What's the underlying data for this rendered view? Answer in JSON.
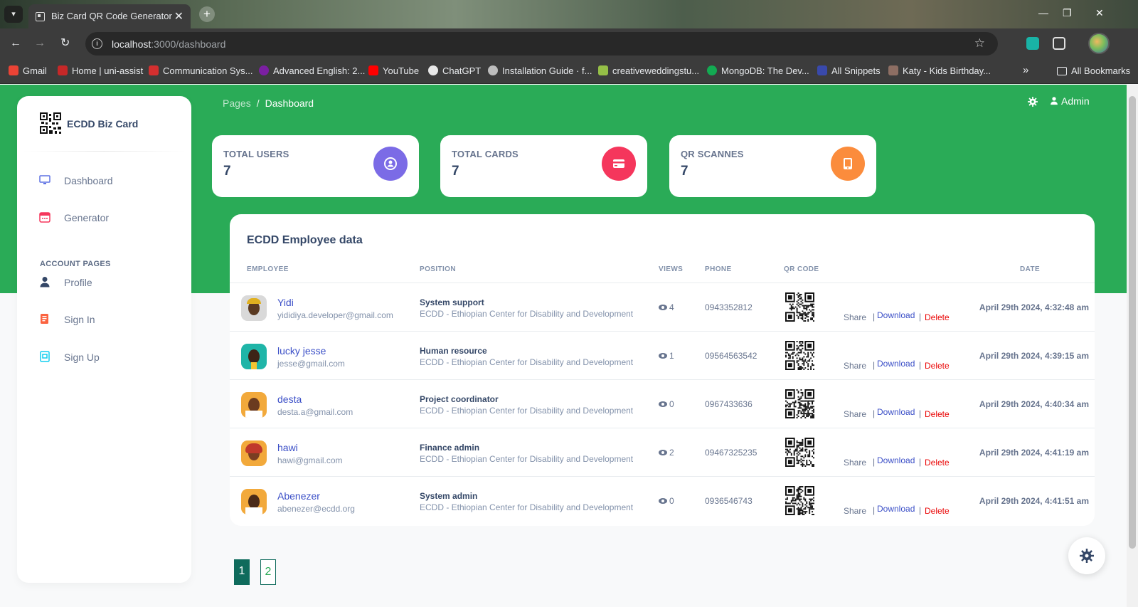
{
  "browser": {
    "tab_title": "Biz Card QR Code Generator",
    "tab_close": "✕",
    "new_tab": "+",
    "url_host": "localhost",
    "url_path": ":3000/dashboard",
    "bookmarks": [
      {
        "label": "Gmail",
        "color": "#ea4335"
      },
      {
        "label": "Home | uni-assist",
        "color": "#c62828"
      },
      {
        "label": "Communication Sys...",
        "color": "#d32f2f"
      },
      {
        "label": "Advanced English: 2...",
        "color": "#7b1fa2"
      },
      {
        "label": "YouTube",
        "color": "#ff0000"
      },
      {
        "label": "ChatGPT",
        "color": "#e8e8e8"
      },
      {
        "label": "Installation Guide · f...",
        "color": "#bdbdbd"
      },
      {
        "label": "creativeweddingstu...",
        "color": "#95bf47"
      },
      {
        "label": "MongoDB: The Dev...",
        "color": "#13aa52"
      },
      {
        "label": "All Snippets",
        "color": "#3949ab"
      },
      {
        "label": "Katy - Kids Birthday...",
        "color": "#8d6e63"
      }
    ],
    "more_bookmarks": "»",
    "all_bookmarks": "All Bookmarks"
  },
  "sidebar": {
    "brand": "ECDD Biz Card",
    "items": [
      {
        "label": "Dashboard",
        "icon": "monitor-icon",
        "color": "#5e72e4"
      },
      {
        "label": "Generator",
        "icon": "calendar-icon",
        "color": "#f5365c"
      }
    ],
    "section_heading": "ACCOUNT PAGES",
    "account_items": [
      {
        "label": "Profile",
        "icon": "user-icon",
        "color": "#344767"
      },
      {
        "label": "Sign In",
        "icon": "document-icon",
        "color": "#fb6340"
      },
      {
        "label": "Sign Up",
        "icon": "id-card-icon",
        "color": "#11cdef"
      }
    ]
  },
  "header": {
    "breadcrumb_parent": "Pages",
    "breadcrumb_sep": "/",
    "breadcrumb_current": "Dashboard",
    "user_label": "Admin"
  },
  "stats": [
    {
      "label": "TOTAL USERS",
      "value": "7",
      "icon": "user-circle-icon",
      "color": "#7b6be6"
    },
    {
      "label": "TOTAL CARDS",
      "value": "7",
      "icon": "credit-card-icon",
      "color": "#f5365c"
    },
    {
      "label": "QR SCANNES",
      "value": "7",
      "icon": "tablet-icon",
      "color": "#fb8c3c"
    }
  ],
  "table": {
    "title": "ECDD Employee data",
    "columns": [
      "EMPLOYEE",
      "POSITION",
      "VIEWS",
      "PHONE",
      "QR CODE",
      "DATE"
    ],
    "action_labels": {
      "share": "Share",
      "download": "Download",
      "delete": "Delete",
      "bar": "|"
    },
    "rows": [
      {
        "name": "Yidi",
        "email": "yididiya.developer@gmail.com",
        "position": "System support",
        "org": "ECDD - Ethiopian Center for Disability and Development",
        "views": "4",
        "phone": "0943352812",
        "date": "April 29th 2024, 4:32:48 am"
      },
      {
        "name": "lucky jesse",
        "email": "jesse@gmail.com",
        "position": "Human resource",
        "org": "ECDD - Ethiopian Center for Disability and Development",
        "views": "1",
        "phone": "09564563542",
        "date": "April 29th 2024, 4:39:15 am"
      },
      {
        "name": "desta",
        "email": "desta.a@gmail.com",
        "position": "Project coordinator",
        "org": "ECDD - Ethiopian Center for Disability and Development",
        "views": "0",
        "phone": "0967433636",
        "date": "April 29th 2024, 4:40:34 am"
      },
      {
        "name": "hawi",
        "email": "hawi@gmail.com",
        "position": "Finance admin",
        "org": "ECDD - Ethiopian Center for Disability and Development",
        "views": "2",
        "phone": "09467325235",
        "date": "April 29th 2024, 4:41:19 am"
      },
      {
        "name": "Abenezer",
        "email": "abenezer@ecdd.org",
        "position": "System admin",
        "org": "ECDD - Ethiopian Center for Disability and Development",
        "views": "0",
        "phone": "0936546743",
        "date": "April 29th 2024, 4:41:51 am"
      }
    ]
  },
  "pagination": {
    "pages": [
      "1",
      "2"
    ],
    "current": "1"
  }
}
